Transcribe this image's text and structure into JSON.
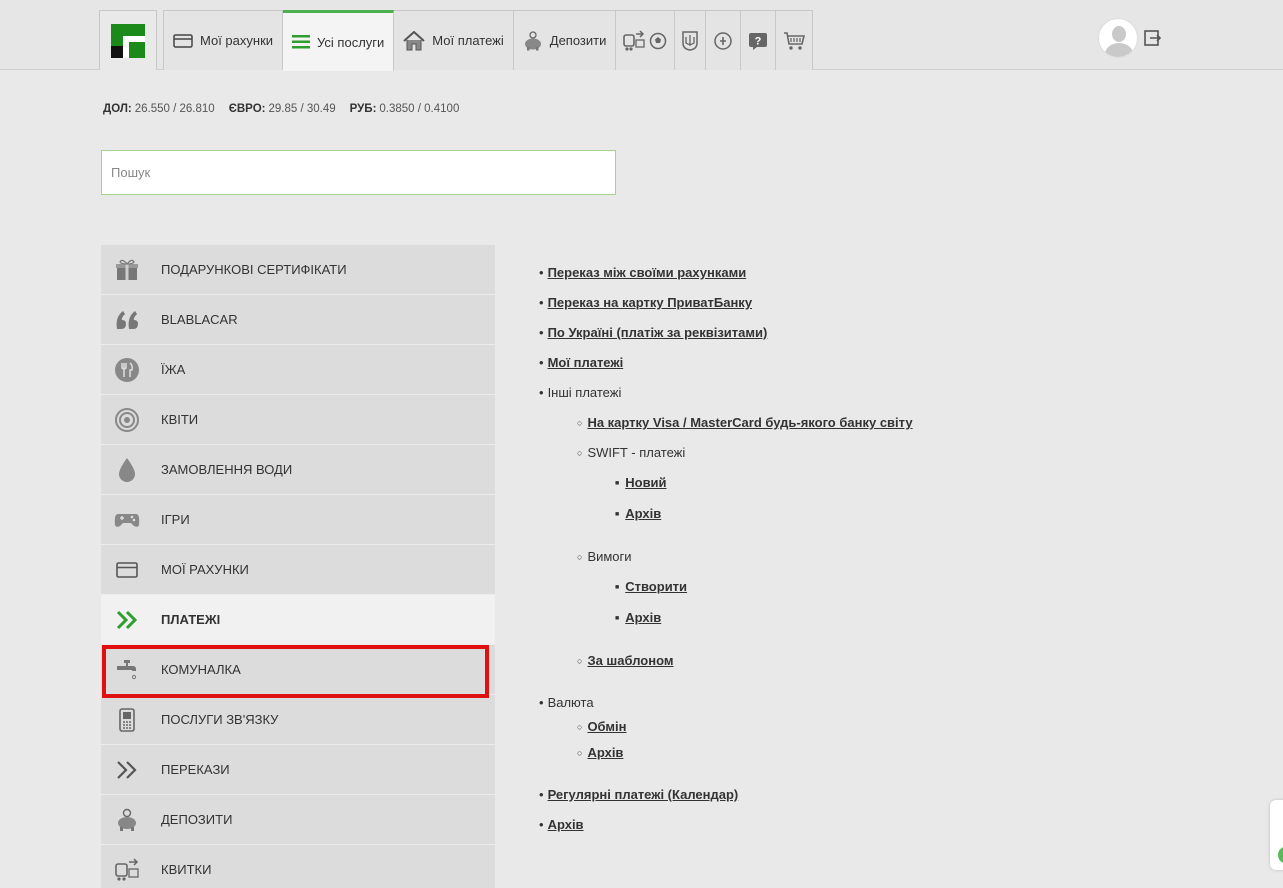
{
  "nav": {
    "tabs": [
      {
        "label": "Мої рахунки",
        "icon": "card-icon"
      },
      {
        "label": "Усі послуги",
        "icon": "list-icon",
        "active": true
      },
      {
        "label": "Мої платежі",
        "icon": "home-icon"
      },
      {
        "label": "Депозити",
        "icon": "piggy-bank-icon"
      }
    ],
    "icon_tabs": [
      "transport-tickets-icon",
      "ukraine-coat-of-arms-icon",
      "pension-icon",
      "help-icon",
      "cart-icon"
    ]
  },
  "rates": {
    "usd_label": "ДОЛ:",
    "usd_value": "26.550 / 26.810",
    "eur_label": "ЄВРО:",
    "eur_value": "29.85 / 30.49",
    "rub_label": "РУБ:",
    "rub_value": "0.3850 / 0.4100"
  },
  "search": {
    "placeholder": "Пошук"
  },
  "sidebar": {
    "items": [
      {
        "label": "Подарункові сертифікати",
        "icon": "gift-icon"
      },
      {
        "label": "BlaBlaCar",
        "icon": "blablacar-icon"
      },
      {
        "label": "Їжа",
        "icon": "food-icon"
      },
      {
        "label": "Квіти",
        "icon": "flower-icon"
      },
      {
        "label": "Замовлення води",
        "icon": "water-drop-icon"
      },
      {
        "label": "Ігри",
        "icon": "gamepad-icon"
      },
      {
        "label": "Мої рахунки",
        "icon": "card-icon"
      },
      {
        "label": "Платежі",
        "icon": "double-chevron-icon",
        "active": true
      },
      {
        "label": "Комуналка",
        "icon": "faucet-icon",
        "highlighted": true
      },
      {
        "label": "Послуги зв'язку",
        "icon": "phone-icon"
      },
      {
        "label": "Перекази",
        "icon": "double-chevron-icon"
      },
      {
        "label": "Депозити",
        "icon": "piggy-bank-icon"
      },
      {
        "label": "Квитки",
        "icon": "transport-tickets-icon"
      }
    ]
  },
  "links": {
    "transfer_own": "Переказ між своїми рахунками",
    "transfer_privat": "Переказ на картку ПриватБанку",
    "ukraine": "По Україні (платіж за реквізитами)",
    "my_payments": "Мої платежі",
    "other": "Інші платежі",
    "visa_mc": "На картку Visa / MasterCard будь-якого банку світу",
    "swift": "SWIFT - платежі",
    "swift_new": "Новий",
    "swift_archive": "Архів",
    "demands": "Вимоги",
    "demands_create": "Створити",
    "demands_archive": "Архів",
    "by_template": "За шаблоном",
    "currency": "Валюта",
    "exchange": "Обмін",
    "currency_archive": "Архів",
    "regular": "Регулярні платежі (Календар)",
    "archive": "Архів"
  },
  "colors": {
    "accent": "#4caf50",
    "highlight": "#e01010",
    "logo_green": "#1b8a1b"
  }
}
